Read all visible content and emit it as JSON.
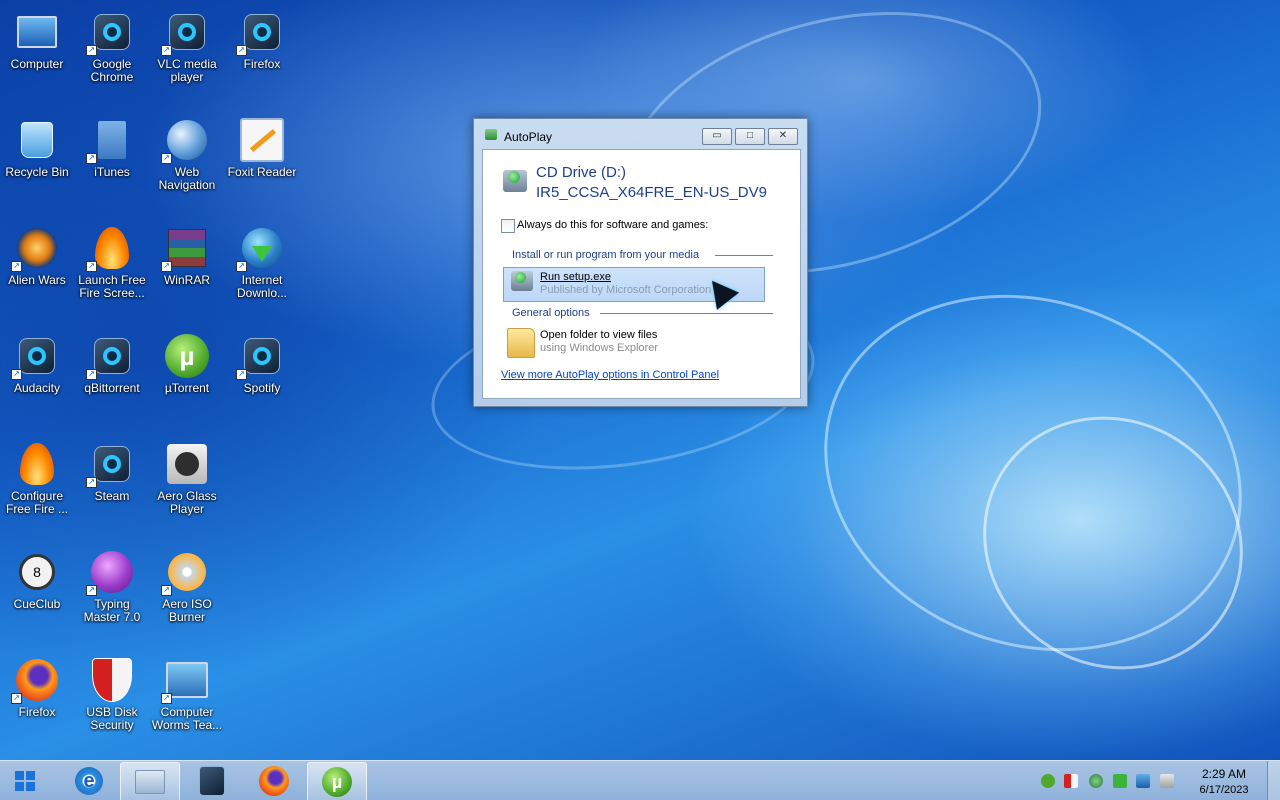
{
  "desktop_icons": [
    {
      "label": "Computer"
    },
    {
      "label": "Google Chrome"
    },
    {
      "label": "VLC media player"
    },
    {
      "label": "Firefox"
    },
    {
      "label": "Recycle Bin"
    },
    {
      "label": "iTunes"
    },
    {
      "label": "Web Navigation"
    },
    {
      "label": "Foxit Reader"
    },
    {
      "label": "Alien Wars"
    },
    {
      "label": "Launch Free Fire Scree..."
    },
    {
      "label": "WinRAR"
    },
    {
      "label": "Internet Downlo..."
    },
    {
      "label": "Audacity"
    },
    {
      "label": "qBittorrent"
    },
    {
      "label": "µTorrent"
    },
    {
      "label": "Spotify"
    },
    {
      "label": "Configure Free Fire ..."
    },
    {
      "label": "Steam"
    },
    {
      "label": "Aero Glass Player"
    },
    {
      "label": "CueClub"
    },
    {
      "label": "Typing Master 7.0"
    },
    {
      "label": "Aero ISO Burner"
    },
    {
      "label": "Firefox"
    },
    {
      "label": "USB Disk Security"
    },
    {
      "label": "Computer Worms Tea..."
    }
  ],
  "dialog": {
    "title": "AutoPlay",
    "drive_name": "CD Drive (D:)",
    "drive_label": "IR5_CCSA_X64FRE_EN-US_DV9",
    "always_checkbox": "Always do this for software and games:",
    "always_checked": false,
    "section_install": "Install or run program from your media",
    "run_setup_title": "Run setup.exe",
    "run_setup_sub": "Published by Microsoft Corporation",
    "section_general": "General options",
    "open_folder_title": "Open folder to view files",
    "open_folder_sub": "using Windows Explorer",
    "more_link": "View more AutoPlay options in Control Panel",
    "minimize_icon": "minimize-icon",
    "maximize_icon": "maximize-icon",
    "close_icon": "close-icon"
  },
  "taskbar": {
    "pinned": [
      "internet-explorer-icon",
      "file-explorer-icon",
      "media-player-icon",
      "firefox-icon",
      "utorrent-icon"
    ],
    "tray_icons": [
      "utorrent-tray-icon",
      "usb-security-tray-icon",
      "network-globe-tray-icon",
      "flag-tray-icon",
      "network-tray-icon",
      "volume-muted-icon"
    ],
    "time": "2:29 AM",
    "date": "6/17/2023"
  }
}
